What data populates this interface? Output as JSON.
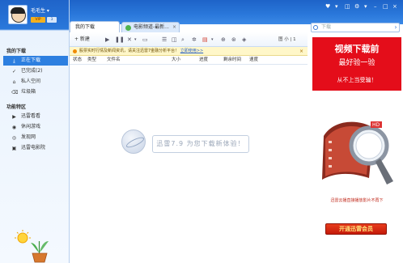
{
  "user": {
    "name": "毛毛生 ▾",
    "vip_label": "VIP",
    "level_label": "3"
  },
  "sidebar": {
    "section_downloads": "我的下载",
    "items": [
      {
        "label": "正在下载",
        "icon": "download-icon"
      },
      {
        "label": "已完成(2)",
        "icon": "check-icon"
      },
      {
        "label": "私人空间",
        "icon": "lock-icon"
      },
      {
        "label": "垃圾箱",
        "icon": "trash-icon"
      }
    ],
    "section_features": "功能特区",
    "features": [
      {
        "label": "迅雷看看",
        "icon": "play-icon"
      },
      {
        "label": "休闲游戏",
        "icon": "gamepad-icon"
      },
      {
        "label": "发现网",
        "icon": "compass-icon"
      },
      {
        "label": "迅雷电影院",
        "icon": "film-icon"
      }
    ]
  },
  "tabs": [
    {
      "label": "我的下载"
    },
    {
      "label": "电影频道-最新..."
    }
  ],
  "toolbar": {
    "new_label": "+ 新建",
    "icons": [
      "play-icon",
      "pause-icon",
      "delete-icon",
      "folder-icon",
      "list-icon",
      "open-icon",
      "search-icon",
      "sort-icon",
      "speed-icon",
      "settings-icon",
      "more-icon",
      "gamepad-icon"
    ],
    "right_label": "图 小 | 1"
  },
  "notice": {
    "text": "股票实时行情及新闻资讯，请关注迅雷7金融分析平台！",
    "link": "立即使用>>",
    "close": "×"
  },
  "columns": [
    "状态",
    "类型",
    "文件名",
    "大小",
    "进度",
    "剩余时间",
    "速度"
  ],
  "empty_message": "迅雷7.9 为您下载新体验！",
  "window_buttons": [
    "♥",
    "▾",
    "◫",
    "⚙",
    "▾",
    "–",
    "□",
    "×"
  ],
  "search": {
    "placeholder": "下载"
  },
  "ad": {
    "title": "视频下载前",
    "subtitle": "最好验一验",
    "tagline": "从不上当受骗！",
    "caption": "迅雷云播直接播放影片不再下",
    "button": "开通迅雷会员"
  }
}
